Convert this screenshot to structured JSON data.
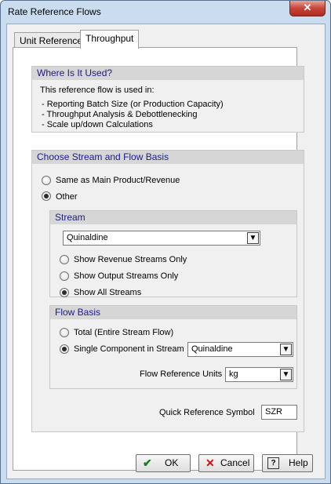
{
  "window": {
    "title": "Rate Reference Flows",
    "close_label": "✕"
  },
  "tabs": [
    {
      "label": "Unit Reference"
    },
    {
      "label": "Throughput"
    }
  ],
  "where_used": {
    "header": "Where Is It Used?",
    "intro": "This reference flow is used in:",
    "items": [
      "- Reporting Batch Size (or Production Capacity)",
      "- Throughput Analysis & Debottlenecking",
      "- Scale up/down Calculations"
    ]
  },
  "choose": {
    "header": "Choose Stream and Flow Basis",
    "options": [
      {
        "label": "Same as Main Product/Revenue",
        "selected": false
      },
      {
        "label": "Other",
        "selected": true
      }
    ]
  },
  "stream": {
    "header": "Stream",
    "combo_value": "Quinaldine",
    "filters": [
      {
        "label": "Show Revenue Streams Only",
        "selected": false
      },
      {
        "label": "Show Output Streams Only",
        "selected": false
      },
      {
        "label": "Show All Streams",
        "selected": true
      }
    ]
  },
  "flow_basis": {
    "header": "Flow Basis",
    "options": [
      {
        "label": "Total (Entire Stream Flow)",
        "selected": false
      },
      {
        "label": "Single Component in Stream",
        "selected": true
      }
    ],
    "component_value": "Quinaldine",
    "units_label": "Flow Reference Units",
    "units_value": "kg"
  },
  "quick_ref": {
    "label": "Quick Reference Symbol",
    "value": "SZR"
  },
  "buttons": {
    "ok": {
      "label": "OK",
      "icon": "check-icon"
    },
    "cancel": {
      "label": "Cancel",
      "icon": "x-icon"
    },
    "help": {
      "label": "Help",
      "icon": "help-icon"
    }
  },
  "colors": {
    "header_text": "#1a1a8c",
    "ok_icon": "#1c7a1c",
    "cancel_icon": "#d01010"
  }
}
